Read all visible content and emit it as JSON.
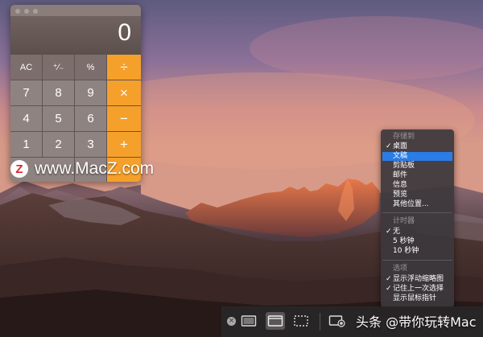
{
  "calculator": {
    "display_value": "0",
    "keys": {
      "ac": "AC",
      "plusminus": "⁺∕₋",
      "percent": "%",
      "divide": "÷",
      "seven": "7",
      "eight": "8",
      "nine": "9",
      "multiply": "×",
      "four": "4",
      "five": "5",
      "six": "6",
      "minus": "−",
      "one": "1",
      "two": "2",
      "three": "3",
      "plus": "+"
    },
    "colors": {
      "operator": "#f5a02b"
    }
  },
  "watermark": {
    "text": "www.MacZ.com",
    "logo_letter": "Z"
  },
  "menu": {
    "save_header": "存储到",
    "save_items": [
      {
        "label": "桌面",
        "checked": true
      },
      {
        "label": "文稿",
        "checked": false,
        "selected": true
      },
      {
        "label": "剪贴板",
        "checked": false
      },
      {
        "label": "邮件",
        "checked": false
      },
      {
        "label": "信息",
        "checked": false
      },
      {
        "label": "预览",
        "checked": false
      },
      {
        "label": "其他位置...",
        "checked": false
      }
    ],
    "timer_header": "计时器",
    "timer_items": [
      {
        "label": "无",
        "checked": true
      },
      {
        "label": "5 秒钟",
        "checked": false
      },
      {
        "label": "10 秒钟",
        "checked": false
      }
    ],
    "options_header": "选项",
    "options_items": [
      {
        "label": "显示浮动缩略图",
        "checked": true
      },
      {
        "label": "记住上一次选择",
        "checked": true
      },
      {
        "label": "显示鼠标指针",
        "checked": false
      }
    ],
    "check_glyph": "✓",
    "colors": {
      "selected": "#2a7ce6"
    }
  },
  "toolbar": {
    "caption": "头条 @带你玩转Mac",
    "close_glyph": "×"
  }
}
